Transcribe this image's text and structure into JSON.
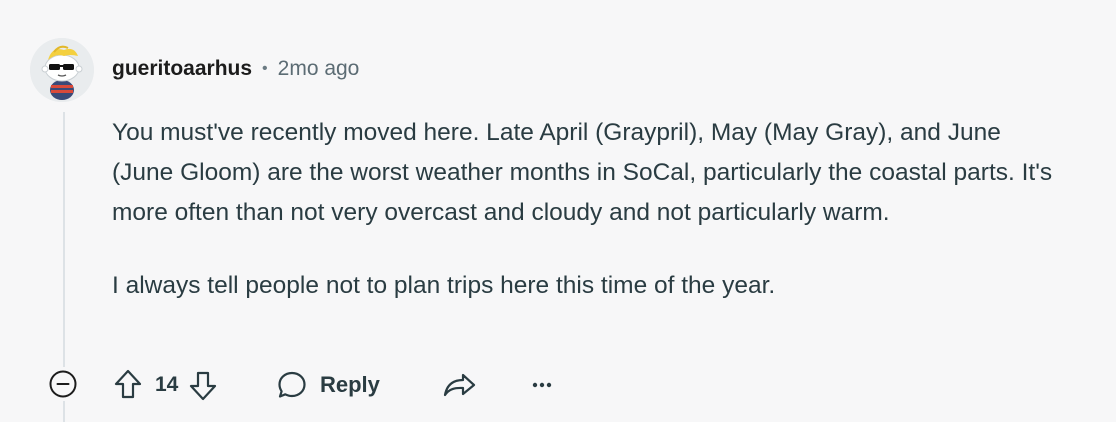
{
  "comment": {
    "username": "gueritoaarhus",
    "separator": "•",
    "timestamp": "2mo ago",
    "paragraphs": [
      "You must've recently moved here. Late April (Graypril), May (May Gray), and June (June Gloom) are the worst weather months in SoCal, particularly the coastal parts. It's more often than not very overcast and cloudy and not particularly warm.",
      "I always tell people not to plan trips here this time of the year."
    ],
    "avatar_icon": "snoo-sunglasses-avatar"
  },
  "actions": {
    "collapse_icon": "collapse-minus-icon",
    "upvote_icon": "upvote-arrow-icon",
    "score": "14",
    "downvote_icon": "downvote-arrow-icon",
    "reply_icon": "speech-bubble-icon",
    "reply_label": "Reply",
    "share_icon": "share-arrow-icon",
    "more_icon": "ellipsis-icon"
  },
  "colors": {
    "background": "#f7f7f8",
    "text": "#2a3c42",
    "muted": "#5c6c74",
    "thread_line": "#dde2e6"
  }
}
